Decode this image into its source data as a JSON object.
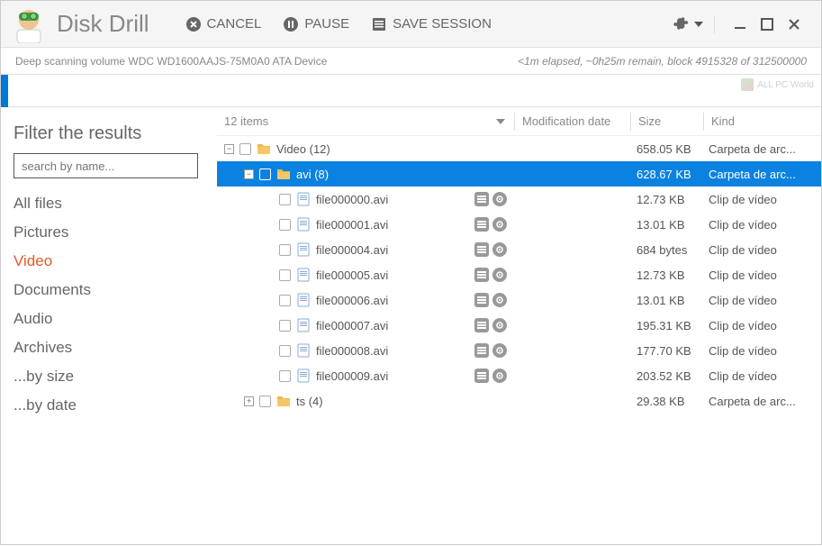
{
  "app": {
    "title": "Disk Drill"
  },
  "header": {
    "cancel": "CANCEL",
    "pause": "PAUSE",
    "save_session": "SAVE SESSION"
  },
  "status": {
    "left": "Deep scanning volume WDC WD1600AAJS-75M0A0 ATA Device",
    "right": "<1m elapsed, ~0h25m remain, block 4915328 of 312500000"
  },
  "watermark": "ALL PC World",
  "sidebar": {
    "title": "Filter the results",
    "search_placeholder": "search by name...",
    "filters": [
      "All files",
      "Pictures",
      "Video",
      "Documents",
      "Audio",
      "Archives",
      "...by size",
      "...by date"
    ],
    "active_index": 2
  },
  "columns": {
    "items_count": "12 items",
    "modification": "Modification date",
    "size": "Size",
    "kind": "Kind"
  },
  "rows": [
    {
      "depth": 0,
      "expander": "-",
      "type": "folder",
      "name": "Video  (12)",
      "size": "658.05 KB",
      "kind": "Carpeta de arc...",
      "selected": false,
      "actions": false
    },
    {
      "depth": 1,
      "expander": "-",
      "type": "folder",
      "name": "avi (8)",
      "size": "628.67 KB",
      "kind": "Carpeta de arc...",
      "selected": true,
      "actions": false
    },
    {
      "depth": 2,
      "expander": "",
      "type": "file",
      "name": "file000000.avi",
      "size": "12.73 KB",
      "kind": "Clip de vídeo",
      "selected": false,
      "actions": true
    },
    {
      "depth": 2,
      "expander": "",
      "type": "file",
      "name": "file000001.avi",
      "size": "13.01 KB",
      "kind": "Clip de vídeo",
      "selected": false,
      "actions": true
    },
    {
      "depth": 2,
      "expander": "",
      "type": "file",
      "name": "file000004.avi",
      "size": "684 bytes",
      "kind": "Clip de vídeo",
      "selected": false,
      "actions": true
    },
    {
      "depth": 2,
      "expander": "",
      "type": "file",
      "name": "file000005.avi",
      "size": "12.73 KB",
      "kind": "Clip de vídeo",
      "selected": false,
      "actions": true
    },
    {
      "depth": 2,
      "expander": "",
      "type": "file",
      "name": "file000006.avi",
      "size": "13.01 KB",
      "kind": "Clip de vídeo",
      "selected": false,
      "actions": true
    },
    {
      "depth": 2,
      "expander": "",
      "type": "file",
      "name": "file000007.avi",
      "size": "195.31 KB",
      "kind": "Clip de vídeo",
      "selected": false,
      "actions": true
    },
    {
      "depth": 2,
      "expander": "",
      "type": "file",
      "name": "file000008.avi",
      "size": "177.70 KB",
      "kind": "Clip de vídeo",
      "selected": false,
      "actions": true
    },
    {
      "depth": 2,
      "expander": "",
      "type": "file",
      "name": "file000009.avi",
      "size": "203.52 KB",
      "kind": "Clip de vídeo",
      "selected": false,
      "actions": true
    },
    {
      "depth": 1,
      "expander": "+",
      "type": "folder",
      "name": "ts  (4)",
      "size": "29.38 KB",
      "kind": "Carpeta de arc...",
      "selected": false,
      "actions": false
    }
  ]
}
